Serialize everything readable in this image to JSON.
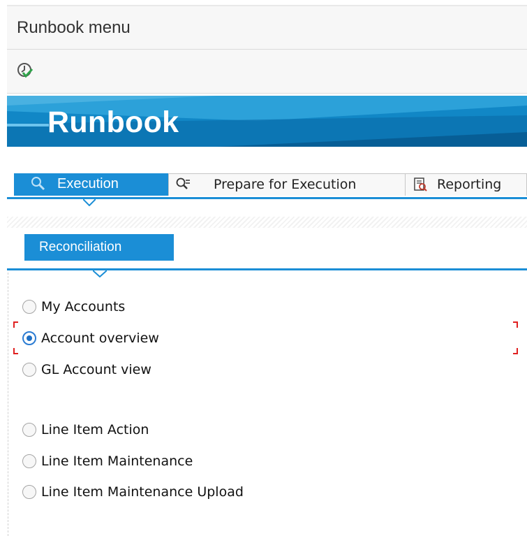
{
  "window": {
    "title": "Runbook menu"
  },
  "toolbar": {
    "execute_icon": "clock-execute-icon"
  },
  "banner": {
    "title": "Runbook"
  },
  "tabs": [
    {
      "label": "Execution",
      "icon": "search-magnifier-icon",
      "active": true
    },
    {
      "label": "Prepare for Execution",
      "icon": "search-list-icon",
      "active": false
    },
    {
      "label": "Reporting",
      "icon": "report-icon",
      "active": false
    }
  ],
  "subtabs": [
    {
      "label": "Reconciliation",
      "active": true
    }
  ],
  "options": [
    {
      "label": "My Accounts",
      "checked": false
    },
    {
      "label": "Account overview",
      "checked": true,
      "focused": true
    },
    {
      "label": "GL Account view",
      "checked": false
    },
    {
      "label": "Line Item Action",
      "checked": false
    },
    {
      "label": "Line Item Maintenance",
      "checked": false
    },
    {
      "label": "Line Item Maintenance Upload",
      "checked": false
    }
  ],
  "colors": {
    "accent": "#1b8ed6",
    "banner": "#1187c6",
    "focus": "#e02020",
    "radio_checked": "#1f6fc4"
  }
}
